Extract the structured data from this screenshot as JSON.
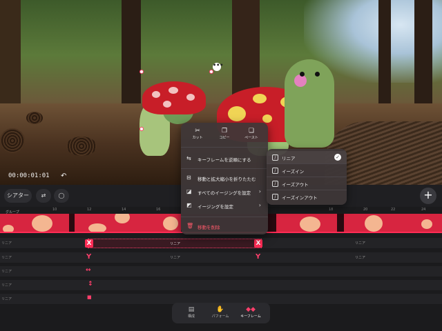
{
  "preview": {
    "timecode": "00:00:01:01",
    "undo_icon": "undo-icon",
    "more_icon": "more-dots-icon",
    "more_label": "•••"
  },
  "toolbar": {
    "scene_label": "シアター",
    "swap_icon": "swap-icon",
    "comment_icon": "comment-bubble-icon",
    "add_label": "+"
  },
  "timeline": {
    "group_label": "グループ",
    "ruler_ticks": [
      "10",
      "12",
      "14",
      "16",
      "18",
      "20",
      "22",
      "24"
    ],
    "tracks": [
      {
        "label": "リニア",
        "mid": "",
        "end": "リニア"
      },
      {
        "label": "リニア",
        "mid": "リニア",
        "end": "リニア"
      },
      {
        "label": "リニア",
        "mid": "",
        "end": ""
      },
      {
        "label": "リニア",
        "mid": "",
        "end": ""
      },
      {
        "label": "リニア",
        "mid": "",
        "end": ""
      }
    ],
    "keyframe_bar_label": "リニア",
    "keyframe_x_label": "X",
    "keyframe_y_label": "Y",
    "move_h_label": "↔",
    "move_v_label": "↕"
  },
  "context_menu": {
    "top_actions": [
      {
        "label": "カット",
        "icon": "scissors-icon",
        "glyph": "✂"
      },
      {
        "label": "コピー",
        "icon": "copy-icon",
        "glyph": "❐"
      },
      {
        "label": "ペースト",
        "icon": "paste-icon",
        "glyph": "❏"
      }
    ],
    "items": [
      {
        "label": "キーフレームを逆順にする",
        "icon": "reverse-icon",
        "glyph": "⇆",
        "submenu": false
      },
      {
        "label": "移動と拡大縮小を折りたたむ",
        "icon": "collapse-icon",
        "glyph": "⊟",
        "submenu": false
      },
      {
        "label": "すべてのイージングを設定",
        "icon": "ease-all-icon",
        "glyph": "◪",
        "submenu": true
      },
      {
        "label": "イージングを設定",
        "icon": "ease-icon",
        "glyph": "◩",
        "submenu": true
      }
    ],
    "delete_label": "移動を削除",
    "delete_icon": "trash-icon",
    "chevron": "›"
  },
  "easing_submenu": {
    "items": [
      {
        "label": "リニア",
        "selected": true
      },
      {
        "label": "イーズイン",
        "selected": false
      },
      {
        "label": "イーズアウト",
        "selected": false
      },
      {
        "label": "イーズインアウト",
        "selected": false
      }
    ],
    "check_glyph": "✓"
  },
  "bottom_nav": {
    "items": [
      {
        "label": "構成",
        "icon": "layers-icon",
        "glyph": "▤",
        "active": false
      },
      {
        "label": "パフォーム",
        "icon": "hand-icon",
        "glyph": "✋",
        "active": false
      },
      {
        "label": "キーフレーム",
        "icon": "keyframe-icon",
        "glyph": "◆◆",
        "active": true
      }
    ]
  },
  "colors": {
    "accent": "#ff2c55",
    "menu_bg": "#3e3738",
    "timeline_bg": "#1b1b1d"
  }
}
